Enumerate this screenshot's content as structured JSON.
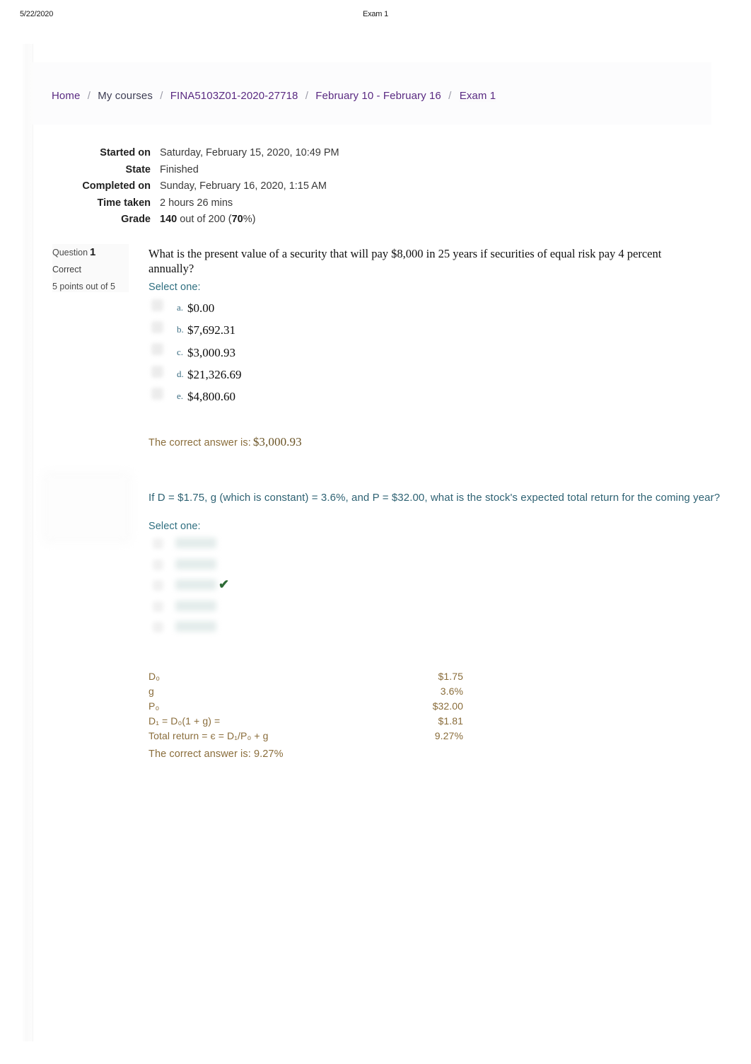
{
  "print_header": {
    "date": "5/22/2020",
    "title": "Exam 1"
  },
  "breadcrumb": {
    "items": [
      {
        "label": "Home",
        "style": "link"
      },
      {
        "label": "My courses",
        "style": "plain"
      },
      {
        "label": "FINA5103Z01-2020-27718",
        "style": "link"
      },
      {
        "label": "February 10 - February 16",
        "style": "link"
      },
      {
        "label": "Exam 1",
        "style": "last"
      }
    ],
    "separator": "/"
  },
  "attempt_summary": {
    "rows": [
      {
        "label": "Started on",
        "value": "Saturday, February 15, 2020, 10:49 PM"
      },
      {
        "label": "State",
        "value": "Finished"
      },
      {
        "label": "Completed on",
        "value": "Sunday, February 16, 2020, 1:15 AM"
      },
      {
        "label": "Time taken",
        "value": "2 hours 26 mins"
      }
    ],
    "grade": {
      "label": "Grade",
      "score": "140",
      "middle": " out of 200 (",
      "percent": "70",
      "suffix": "%)"
    }
  },
  "question1": {
    "info": {
      "question_word": "Question",
      "number": "1",
      "state": "Correct",
      "points": "5 points out of 5"
    },
    "text": "What is the present value of a security that will pay $8,000 in 25 years if securities of equal risk pay 4 percent annually?",
    "select_one": "Select one:",
    "options": [
      {
        "letter": "a.",
        "text": "$0.00"
      },
      {
        "letter": "b.",
        "text": "$7,692.31"
      },
      {
        "letter": "c.",
        "text": "$3,000.93"
      },
      {
        "letter": "d.",
        "text": "$21,326.69"
      },
      {
        "letter": "e.",
        "text": "$4,800.60"
      }
    ],
    "correct_answer_label": "The correct answer is:",
    "correct_answer_value": "$3,000.93"
  },
  "question2": {
    "text": "If D  = $1.75, g (which is constant) = 3.6%, and P  = $32.00, what is the stock's expected total return for the coming year?",
    "select_one": "Select one:",
    "options_redacted_count": 5,
    "checked_option_index": 2,
    "check_icon": "✔",
    "calculation": [
      {
        "key": "D₀",
        "value": "$1.75"
      },
      {
        "key": "g",
        "value": "3.6%"
      },
      {
        "key": "P₀",
        "value": "$32.00"
      },
      {
        "key": "D₁ = D₀(1 + g) =",
        "value": "$1.81"
      },
      {
        "key": "Total return = є = D₁/P₀ + g",
        "value": "9.27%"
      }
    ],
    "correct_answer_line": "The correct answer is: 9.27%"
  },
  "colors": {
    "breadcrumb_link": "#5a2a82",
    "teal": "#2e6273",
    "olive": "#8a6d3b",
    "check_green": "#2d6a35",
    "info_box_bg": "#fafafa"
  }
}
